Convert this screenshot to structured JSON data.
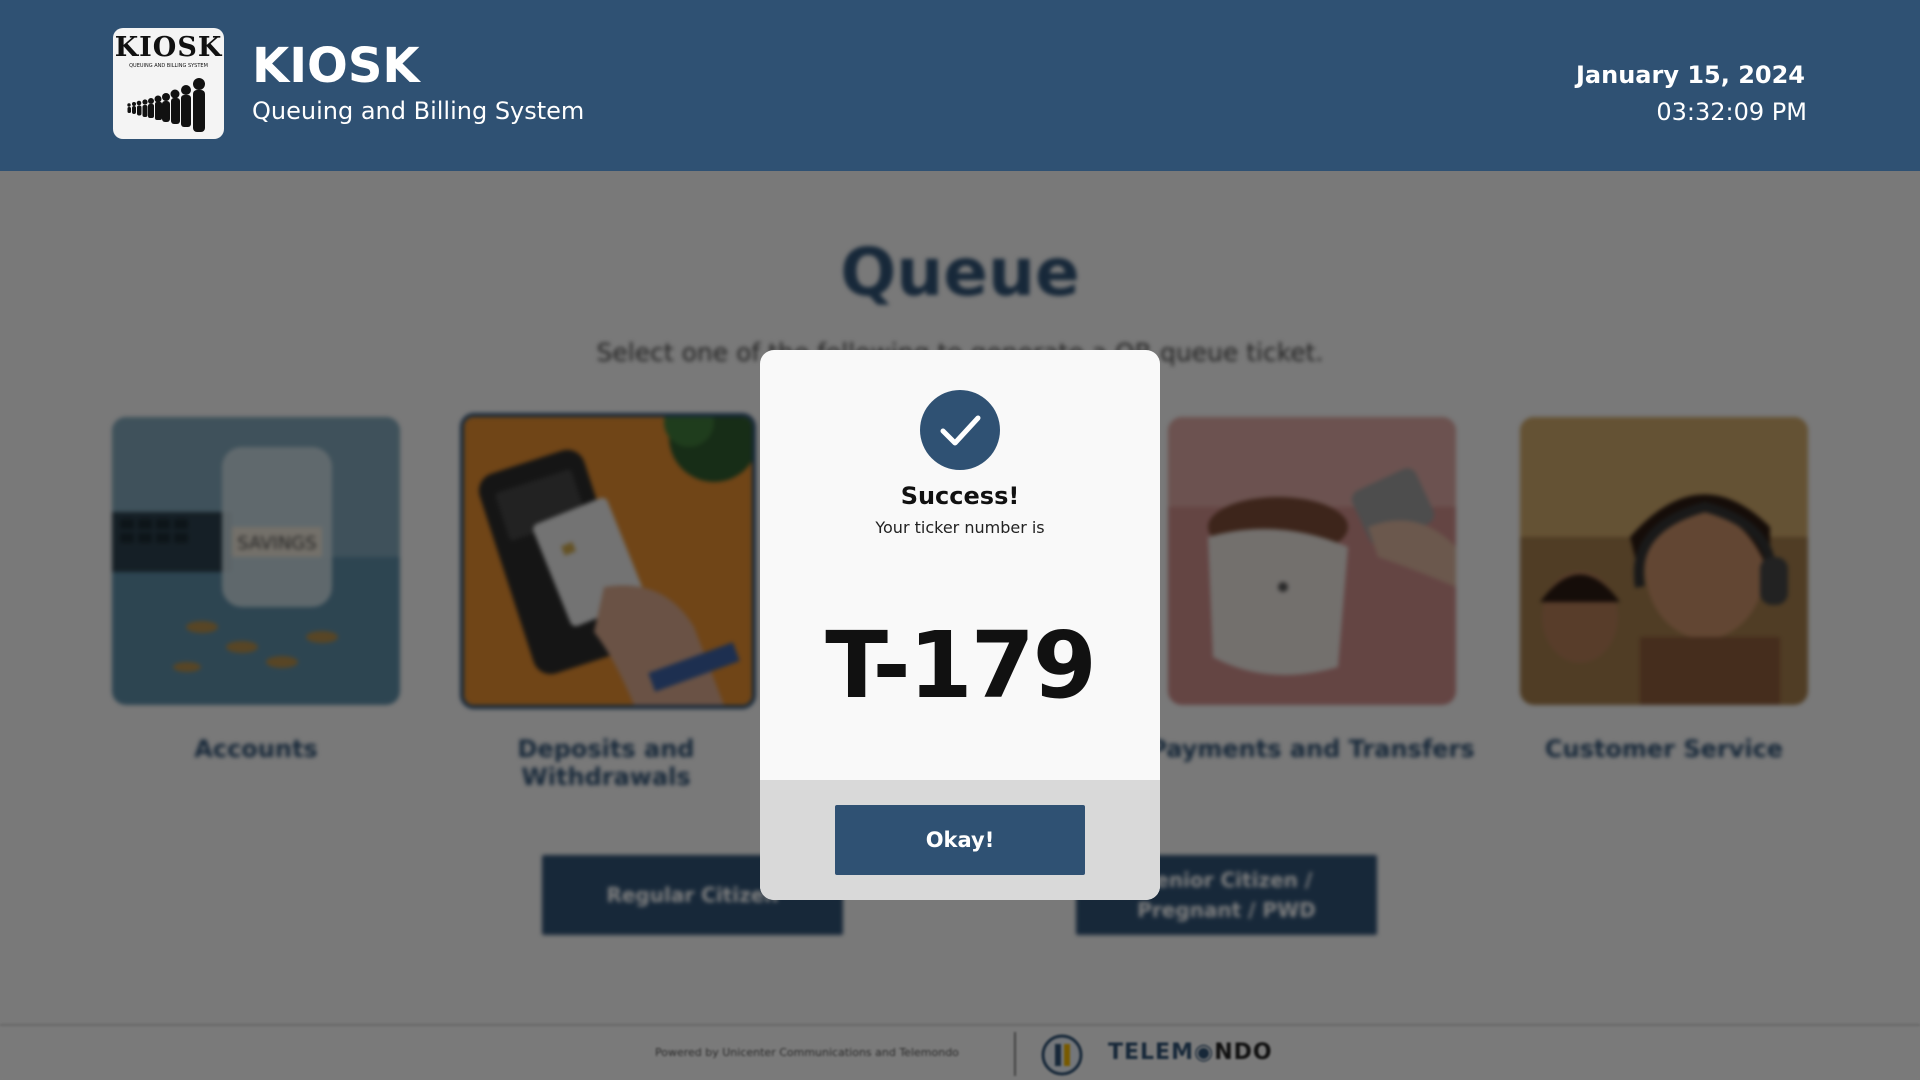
{
  "header": {
    "logo_text": "KIOSK",
    "logo_subtext": "QUEUING AND BILLING SYSTEM",
    "title": "KIOSK",
    "subtitle": "Queuing and Billing System",
    "date": "January 15, 2024",
    "time": "03:32:09 PM"
  },
  "main": {
    "title": "Queue",
    "subtitle": "Select one of the following to generate a QR queue ticket.",
    "services": [
      {
        "label": "Accounts",
        "image": "savings-jar-photo",
        "selected": false
      },
      {
        "label": "Deposits and Withdrawals",
        "image": "card-terminal-photo",
        "selected": true
      },
      {
        "label": "",
        "image": "hidden-behind-modal",
        "selected": false
      },
      {
        "label": "Payments and Transfers",
        "image": "wallet-payment-photo",
        "selected": false
      },
      {
        "label": "Customer Service",
        "image": "headset-agent-photo",
        "selected": false
      }
    ],
    "buttons": {
      "regular": "Regular Citizen",
      "priority": "Senior Citizen / Pregnant / PWD"
    }
  },
  "footer": {
    "powered_by": "Powered by Unicenter Communications and Telemondo",
    "brand_left": "TELEM",
    "brand_right": "NDO"
  },
  "modal": {
    "icon": "check-icon",
    "title": "Success!",
    "message": "Your ticker number is",
    "ticket_number": "T-179",
    "button_label": "Okay!"
  },
  "colors": {
    "primary": "#2f5173",
    "overlay": "rgba(0,0,0,0.5)"
  }
}
